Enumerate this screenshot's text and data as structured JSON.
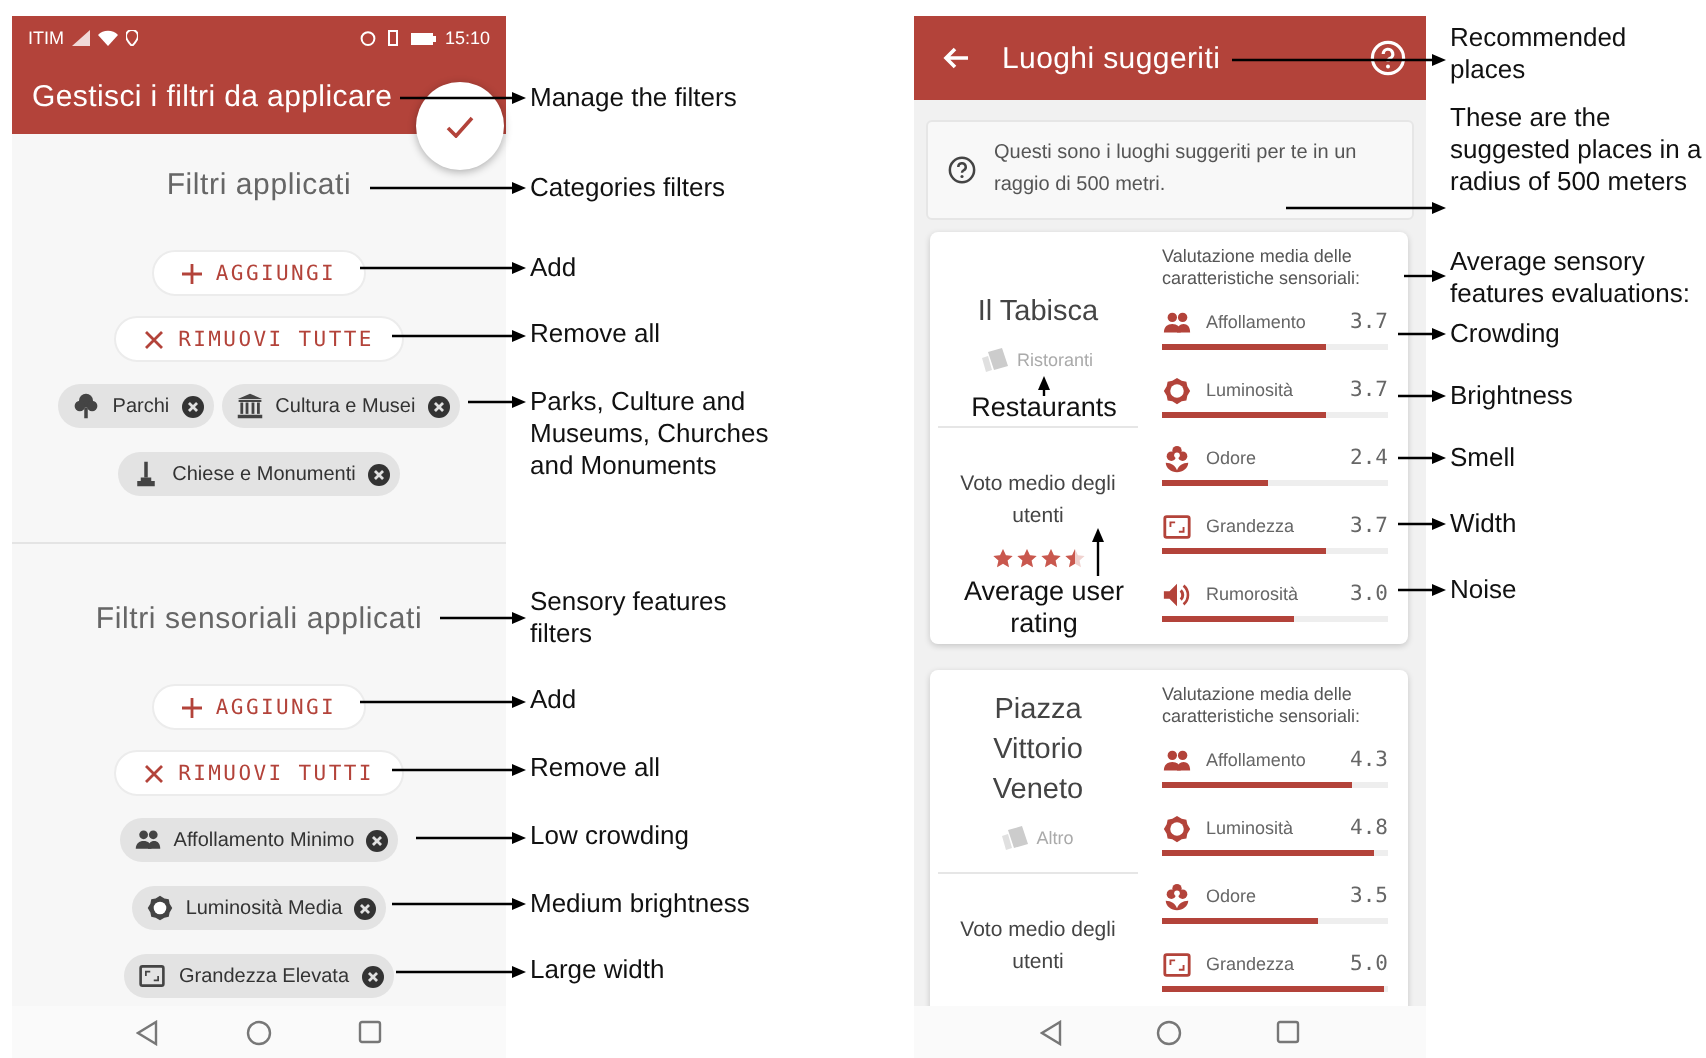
{
  "left_screen": {
    "status_bar": {
      "carrier": "ITIM",
      "time": "15:10"
    },
    "app_bar": {
      "title": "Gestisci i filtri da applicare"
    },
    "sections": [
      {
        "title": "Filtri applicati",
        "add_button": "AGGIUNGI",
        "remove_button": "RIMUOVI TUTTE",
        "chips": [
          {
            "label": "Parchi"
          },
          {
            "label": "Cultura e Musei"
          },
          {
            "label": "Chiese e Monumenti"
          }
        ]
      },
      {
        "title": "Filtri sensoriali applicati",
        "add_button": "AGGIUNGI",
        "remove_button": "RIMUOVI TUTTI",
        "chips": [
          {
            "label": "Affollamento Minimo"
          },
          {
            "label": "Luminosità Media"
          },
          {
            "label": "Grandezza Elevata"
          }
        ]
      }
    ]
  },
  "right_screen": {
    "app_bar": {
      "title": "Luoghi suggeriti"
    },
    "info": "Questi sono i luoghi suggeriti per te in un raggio di 500 metri.",
    "places": [
      {
        "name": "Il Tabisca",
        "category": "Ristoranti",
        "rating_label": "Voto medio degli utenti",
        "stars": 3.5,
        "features_title": "Valutazione media delle caratteristiche sensoriali:",
        "features": [
          {
            "label": "Affollamento",
            "value": "3.7",
            "level": 0.74
          },
          {
            "label": "Luminosità",
            "value": "3.7",
            "level": 0.74
          },
          {
            "label": "Odore",
            "value": "2.4",
            "level": 0.48
          },
          {
            "label": "Grandezza",
            "value": "3.7",
            "level": 0.74
          },
          {
            "label": "Rumorosità",
            "value": "3.0",
            "level": 0.6
          }
        ]
      },
      {
        "name": "Piazza Vittorio Veneto",
        "category": "Altro",
        "rating_label": "Voto medio degli utenti",
        "features_title": "Valutazione media delle caratteristiche sensoriali:",
        "features": [
          {
            "label": "Affollamento",
            "value": "4.3",
            "level": 0.86
          },
          {
            "label": "Luminosità",
            "value": "4.8",
            "level": 0.96
          },
          {
            "label": "Odore",
            "value": "3.5",
            "level": 0.7
          },
          {
            "label": "Grandezza",
            "value": "5.0",
            "level": 1.0
          }
        ]
      }
    ]
  },
  "annotations": {
    "left": [
      "Manage the filters",
      "Categories filters",
      "Add",
      "Remove all",
      "Parks, Culture and Museums, Churches and Monuments",
      "Sensory features filters",
      "Add",
      "Remove all",
      "Low crowding",
      "Medium brightness",
      "Large width"
    ],
    "right": [
      "Recommended places",
      "These are the suggested places in a radius of 500 meters",
      "Average sensory features evaluations:",
      "Crowding",
      "Brightness",
      "Smell",
      "Width",
      "Noise"
    ],
    "inline": [
      "Restaurants",
      "Average user rating"
    ]
  }
}
